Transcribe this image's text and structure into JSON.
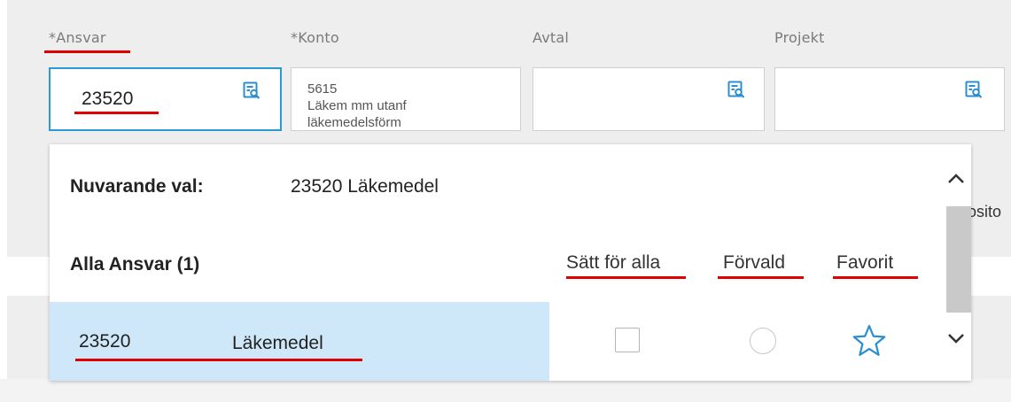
{
  "fields": {
    "ansvar": {
      "label": "*Ansvar",
      "value": "23520"
    },
    "konto": {
      "label": "*Konto",
      "line1": "5615",
      "line2": "Läkem mm utanf",
      "line3": "läkemedelsförm"
    },
    "avtal": {
      "label": "Avtal",
      "value": ""
    },
    "projekt": {
      "label": "Projekt",
      "value": ""
    }
  },
  "side_text": "osito",
  "dropdown": {
    "current_label": "Nuvarande val:",
    "current_value": "23520 Läkemedel",
    "all_label": "Alla Ansvar (1)",
    "columns": {
      "set_all": "Sätt för alla",
      "default": "Förvald",
      "favorite": "Favorit"
    },
    "row": {
      "code": "23520",
      "name": "Läkemedel",
      "set_all_checked": false,
      "default_selected": false,
      "favorite": false
    }
  },
  "colors": {
    "accent": "#2f97d6",
    "highlight": "#cfe8f9",
    "annotation": "#e00000",
    "icon": "#2a8fd0"
  },
  "icons": [
    "lookup-icon",
    "star-icon",
    "chevron-up-icon",
    "chevron-down-icon"
  ]
}
